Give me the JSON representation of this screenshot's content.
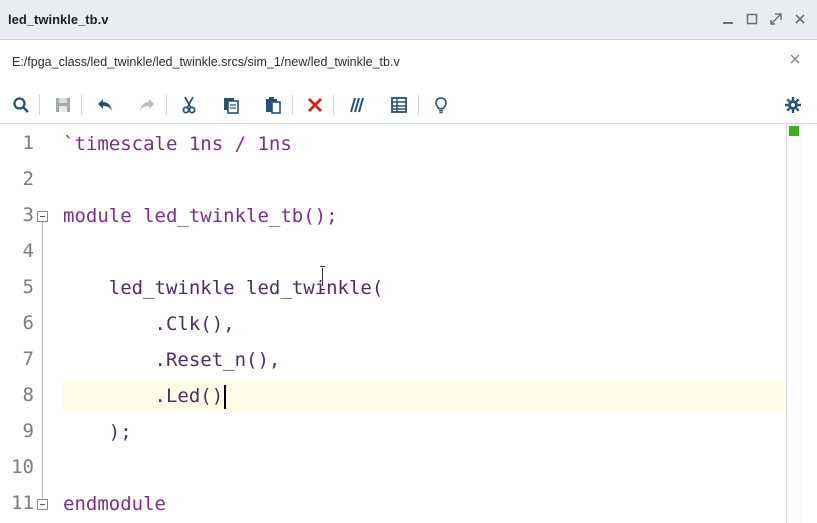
{
  "window": {
    "title": "led_twinkle_tb.v",
    "controls": [
      "minimize-icon",
      "restore-icon",
      "maximize-icon",
      "close-icon"
    ]
  },
  "path": {
    "text": "E:/fpga_class/led_twinkle/led_twinkle.srcs/sim_1/new/led_twinkle_tb.v"
  },
  "toolbar": {
    "icons": [
      "search-icon",
      "save-icon",
      "undo-icon",
      "redo-icon",
      "cut-icon",
      "copy-icon",
      "paste-icon",
      "delete-icon",
      "comment-icon",
      "column-mode-icon",
      "lightbulb-icon",
      "settings-icon"
    ]
  },
  "editor": {
    "lines": [
      {
        "num": "1",
        "text": "`timescale 1ns / 1ns"
      },
      {
        "num": "2",
        "text": ""
      },
      {
        "num": "3",
        "text": "module led_twinkle_tb();"
      },
      {
        "num": "4",
        "text": ""
      },
      {
        "num": "5",
        "text": "    led_twinkle led_twinkle("
      },
      {
        "num": "6",
        "text": "        .Clk(),"
      },
      {
        "num": "7",
        "text": "        .Reset_n(),"
      },
      {
        "num": "8",
        "text": "        .Led()"
      },
      {
        "num": "9",
        "text": "    );"
      },
      {
        "num": "10",
        "text": ""
      },
      {
        "num": "11",
        "text": "endmodule"
      }
    ],
    "current_line": 8
  },
  "colors": {
    "keyword": "#7b2f8f",
    "text": "#4e2f62",
    "current_line_bg": "#fdfde7",
    "status_ok": "#39b11f"
  }
}
